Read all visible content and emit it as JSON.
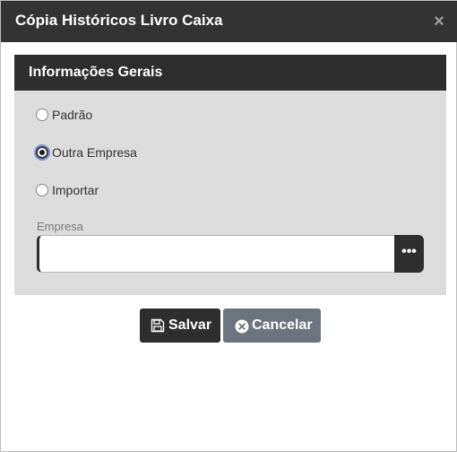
{
  "dialog": {
    "title": "Cópia Históricos Livro Caixa",
    "close_glyph": "×"
  },
  "panel": {
    "header": "Informações Gerais",
    "options": [
      {
        "label": "Padrão",
        "checked": false
      },
      {
        "label": "Outra Empresa",
        "checked": true
      },
      {
        "label": "Importar",
        "checked": false
      }
    ],
    "empresa": {
      "label": "Empresa",
      "value": "",
      "lookup_glyph": "•••"
    }
  },
  "buttons": {
    "save_label": "Salvar",
    "cancel_label": "Cancelar"
  },
  "icons": {
    "close": "close-icon",
    "save": "floppy-disk-icon",
    "cancel": "x-circle-icon",
    "lookup": "ellipsis-icon"
  },
  "colors": {
    "titlebar": "#333333",
    "panel_bg": "#dcdcdc",
    "save_btn": "#2e2e2e",
    "cancel_btn": "#6c757d",
    "radio_focus": "#7c90d4"
  }
}
